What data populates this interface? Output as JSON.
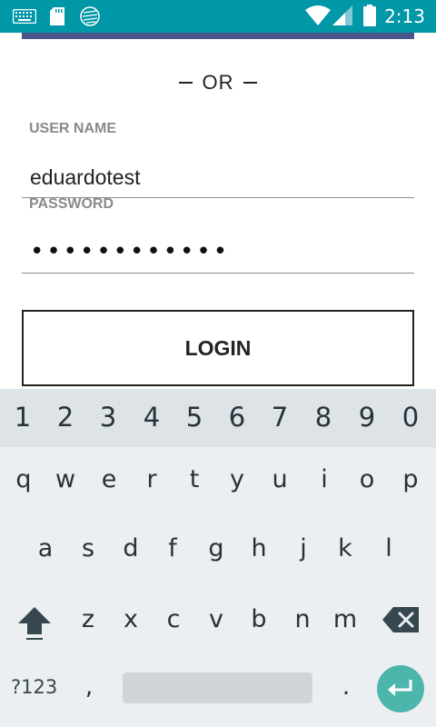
{
  "status_bar": {
    "time": "2:13",
    "icons": [
      "keyboard-icon",
      "sd-card-icon",
      "sync-icon",
      "wifi-icon",
      "cell-signal-icon",
      "battery-icon"
    ]
  },
  "form": {
    "separator_text": "OR",
    "username": {
      "label": "USER NAME",
      "value": "eduardotest"
    },
    "password": {
      "label": "PASSWORD",
      "value_masked": "••••••••••••"
    },
    "login_button": "LOGIN"
  },
  "keyboard": {
    "number_row": [
      "1",
      "2",
      "3",
      "4",
      "5",
      "6",
      "7",
      "8",
      "9",
      "0"
    ],
    "row1": [
      "q",
      "w",
      "e",
      "r",
      "t",
      "y",
      "u",
      "i",
      "o",
      "p"
    ],
    "row2": [
      "a",
      "s",
      "d",
      "f",
      "g",
      "h",
      "j",
      "k",
      "l"
    ],
    "row3": [
      "z",
      "x",
      "c",
      "v",
      "b",
      "n",
      "m"
    ],
    "symbols_label": "?123",
    "comma": ",",
    "period": ".",
    "icons": {
      "shift": "shift-icon",
      "backspace": "backspace-icon",
      "enter": "enter-icon"
    }
  },
  "colors": {
    "status_bar": "#0097a7",
    "banner": "#4a5589",
    "enter_key": "#4db6ac",
    "keyboard_bg": "#eceff1"
  }
}
